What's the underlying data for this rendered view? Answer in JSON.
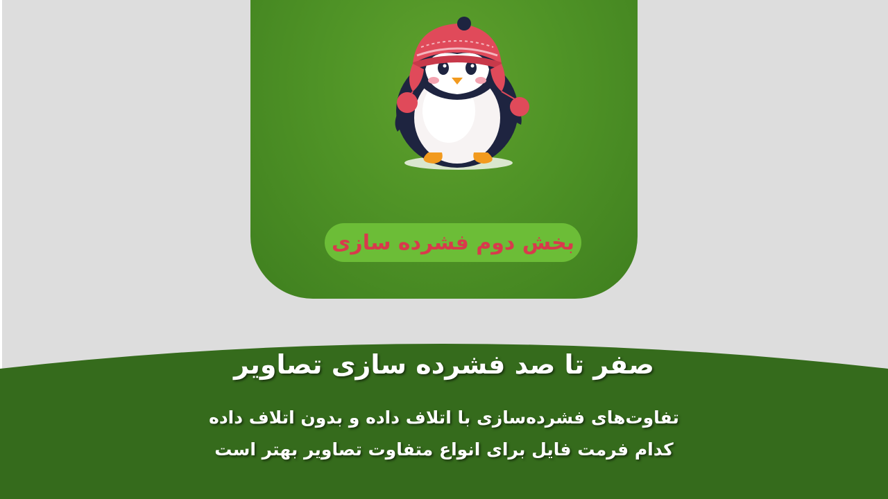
{
  "hero": {
    "badge_label": "بخش دوم فشرده سازی",
    "image_icon": "penguin-with-knit-hat-icon"
  },
  "footer": {
    "title": "صفر تا صد فشرده سازی تصاویر",
    "lines": [
      "تفاوت‌های فشرده‌سازی با اتلاف داده و بدون اتلاف داده",
      "کدام فرمت فایل برای انواع متفاوت تصاویر بهتر است"
    ]
  },
  "colors": {
    "page_background": "#dddddd",
    "card_green": "#4f9326",
    "pill_green": "#6cbd37",
    "pill_text": "#d83a4c",
    "band_green": "#356b1c",
    "text_white": "#ffffff"
  }
}
